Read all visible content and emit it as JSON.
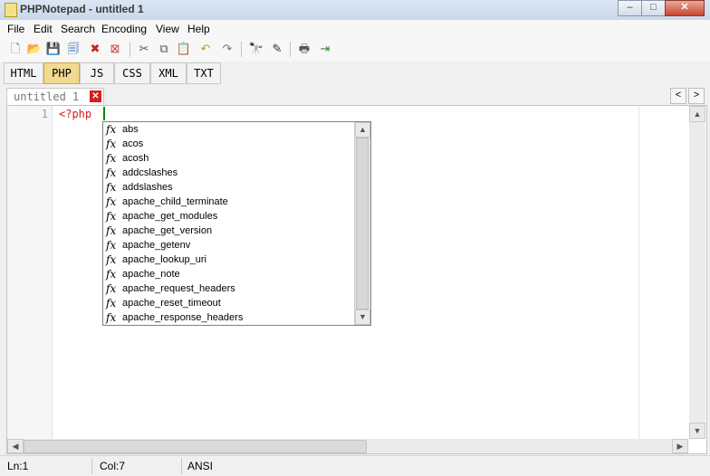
{
  "window": {
    "title": "PHPNotepad - untitled 1",
    "minimize": "–",
    "maximize": "□",
    "close": "✕"
  },
  "menu": [
    "File",
    "Edit",
    "Search",
    "Encoding",
    "View",
    "Help"
  ],
  "toolbar": [
    {
      "name": "new-icon",
      "glyph": "🗋",
      "color": "#4a7fc1"
    },
    {
      "name": "open-icon",
      "glyph": "📂",
      "color": "#d9a526"
    },
    {
      "name": "save-icon",
      "glyph": "💾",
      "color": "#2d5fa8"
    },
    {
      "name": "save-all-icon",
      "glyph": "🗐",
      "color": "#2d5fa8"
    },
    {
      "name": "close-icon",
      "glyph": "✖",
      "color": "#cc2222"
    },
    {
      "name": "close-all-icon",
      "glyph": "⊠",
      "color": "#cc4444"
    },
    {
      "name": "cut-icon",
      "glyph": "✂",
      "color": "#555555"
    },
    {
      "name": "copy-icon",
      "glyph": "⧉",
      "color": "#555555"
    },
    {
      "name": "paste-icon",
      "glyph": "📋",
      "color": "#b98a2e"
    },
    {
      "name": "undo-icon",
      "glyph": "↶",
      "color": "#c79a1e"
    },
    {
      "name": "redo-icon",
      "glyph": "↷",
      "color": "#777777"
    },
    {
      "name": "find-icon",
      "glyph": "🔭",
      "color": "#333333"
    },
    {
      "name": "replace-icon",
      "glyph": "✎",
      "color": "#333333"
    },
    {
      "name": "print-icon",
      "glyph": "🖶",
      "color": "#555555"
    },
    {
      "name": "exit-icon",
      "glyph": "⇥",
      "color": "#3a8a3a"
    }
  ],
  "languages": [
    {
      "label": "HTML",
      "active": false
    },
    {
      "label": "PHP",
      "active": true
    },
    {
      "label": "JS",
      "active": false
    },
    {
      "label": "CSS",
      "active": false
    },
    {
      "label": "XML",
      "active": false
    },
    {
      "label": "TXT",
      "active": false
    }
  ],
  "tab": {
    "label": "untitled 1",
    "close": "✕"
  },
  "nav": {
    "prev": "<",
    "next": ">"
  },
  "editor": {
    "line_number": "1",
    "code": "<?php"
  },
  "autocomplete": {
    "icon": "fx",
    "items": [
      "abs",
      "acos",
      "acosh",
      "addcslashes",
      "addslashes",
      "apache_child_terminate",
      "apache_get_modules",
      "apache_get_version",
      "apache_getenv",
      "apache_lookup_uri",
      "apache_note",
      "apache_request_headers",
      "apache_reset_timeout",
      "apache_response_headers"
    ]
  },
  "status": {
    "line": "Ln:1",
    "col": "Col:7",
    "encoding": "ANSI"
  },
  "scroll": {
    "up": "▲",
    "down": "▼",
    "left": "◀",
    "right": "▶"
  }
}
